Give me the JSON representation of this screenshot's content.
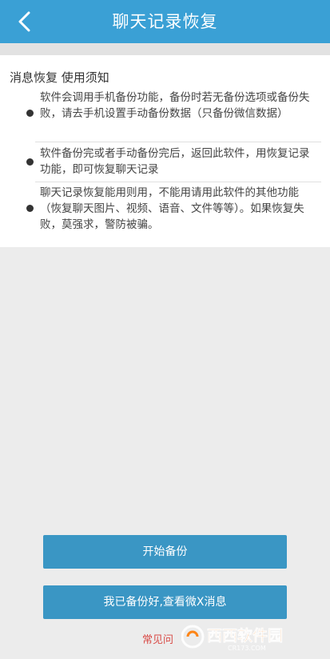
{
  "header": {
    "title": "聊天记录恢复"
  },
  "notice": {
    "title": "消息恢复 使用须知",
    "items": [
      {
        "text": "软件会调用手机备份功能，备份时若无备份选项或备份失败，请去手机设置手动备份数据（只备份微信数据）"
      },
      {
        "text": "软件备份完或者手动备份完后，返回此软件，用恢复记录功能，即可恢复聊天记录"
      },
      {
        "text": "聊天记录恢复能用则用，不能用请用此软件的其他功能（恢复聊天图片、视频、语音、文件等等）。如果恢复失败，莫强求，警防被骗。"
      }
    ]
  },
  "actions": {
    "start_backup_label": "开始备份",
    "view_messages_label": "我已备份好,查看微X消息"
  },
  "footer": {
    "faq_label": "常见问"
  },
  "watermark": {
    "brand": "西西软件园",
    "url": "CR173.COM"
  },
  "colors": {
    "header": "#3aa0d5",
    "button": "#3a96c4",
    "faq": "#d94b47",
    "background": "#ececec"
  }
}
